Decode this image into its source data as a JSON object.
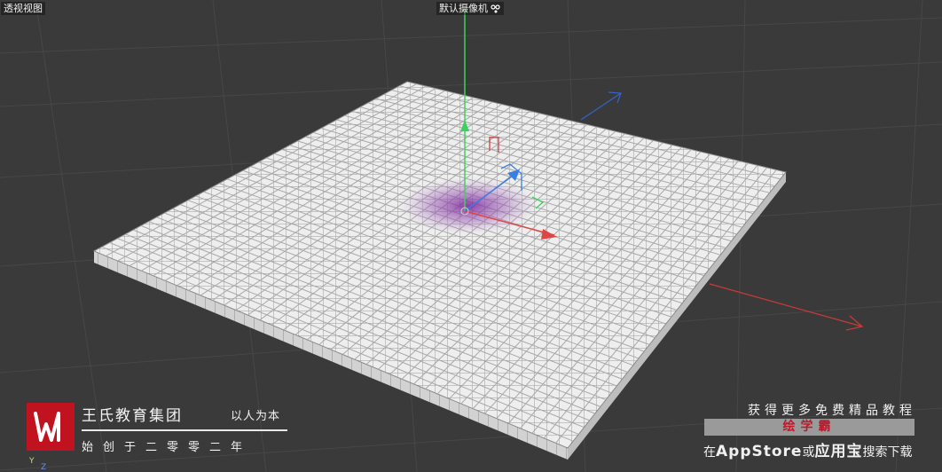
{
  "viewport": {
    "view_name": "透视视图",
    "camera_name": "默认摄像机",
    "camera_icon": "camera-icon"
  },
  "axes": {
    "y_label": "Y",
    "z_label": "Z",
    "colors": {
      "x": "#e04545",
      "y": "#3fcf5f",
      "z": "#3a7fe0",
      "ground_x": "#c83a3a",
      "ground_z": "#3464c8"
    }
  },
  "watermark": {
    "brand_name": "王氏教育集团",
    "motto": "以人为本",
    "founded": "始创于二零零二年",
    "logo_color": "#c1121f"
  },
  "promo": {
    "line1": "获得更多免费精品教程",
    "badge": "绘学霸",
    "line3_prefix": "在",
    "app_store": "AppStore",
    "or": "或",
    "app_treasure": "应用宝",
    "line3_suffix": "搜索下载"
  }
}
